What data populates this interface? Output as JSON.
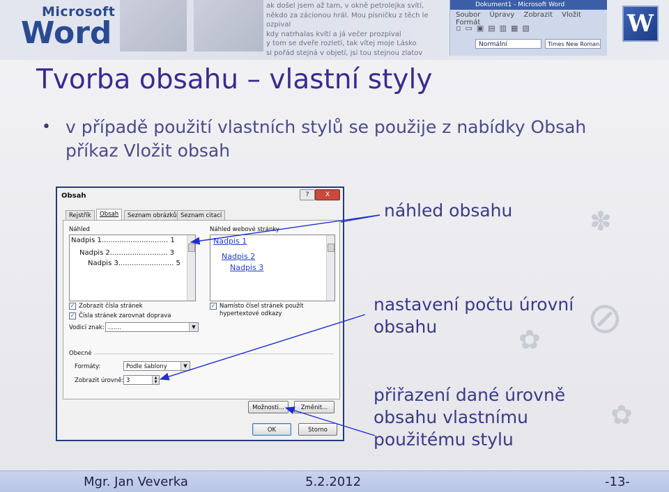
{
  "banner": {
    "logo_top": "Microsoft",
    "logo_main": "Word",
    "poem_lines": [
      "ak došel jsem až tam, v okně petrolejka svítí,",
      "někdo za zácionou hrál. Mou písničku z těch le",
      "ozpival",
      "kdy natrhalas kvítí a já večer prozpíval",
      "y tom se dveře rozletí, tak vítej moje Lásko",
      "si pořád stejná v objetí, jsi tou stejnou zlatov"
    ],
    "mini_word": {
      "title": "Dokument1 - Microsoft Word",
      "menu": "Soubor Úpravy Zobrazit Vložit Formát",
      "style": "Normální",
      "font": "Times New Roman"
    }
  },
  "title": "Tvorba obsahu – vlastní styly",
  "bullet": "v případě použití vlastních stylů se použije z nabídky Obsah příkaz Vložit obsah",
  "dialog": {
    "title": "Obsah",
    "title_buttons": [
      "?",
      "X"
    ],
    "tabs": [
      "Rejstřík",
      "Obsah",
      "Seznam obrázků",
      "Seznam citací"
    ],
    "active_tab": "Obsah",
    "print_preview_label": "Náhled",
    "print_preview_lines": [
      "Nadpis 1.............................. 1",
      "Nadpis 2.......................... 3",
      "Nadpis 3......................... 5"
    ],
    "web_preview_label": "Náhled webové stránky",
    "web_preview_links": [
      "Nadpis 1",
      "Nadpis 2",
      "Nadpis 3"
    ],
    "show_page_numbers": "Zobrazit čísla stránek",
    "align_right": "Čísla stránek zarovnat doprava",
    "leader_label": "Vodicí znak:",
    "leader_value": ".......",
    "hyperlinks": "Namísto čísel stránek použít hypertextové odkazy",
    "general_label": "Obecné",
    "formats_label": "Formáty:",
    "formats_value": "Podle šablony",
    "levels_label": "Zobrazit úrovně:",
    "levels_value": "3",
    "options_button": "Možnosti...",
    "modify_button": "Změnit...",
    "ok_button": "OK",
    "cancel_button": "Storno"
  },
  "annotations": {
    "preview": "náhled obsahu",
    "levels": "nastavení počtu úrovní obsahu",
    "assign": "přiřazení dané úrovně obsahu vlastnímu použitému stylu"
  },
  "footer": {
    "author": "Mgr. Jan Veverka",
    "date": "5.2.2012",
    "page": "-13-"
  },
  "colors": {
    "title": "#3b2a8f",
    "text": "#4a4a8a",
    "footer_bg": "#c3cdeb",
    "arrow": "#1f2fd0"
  }
}
